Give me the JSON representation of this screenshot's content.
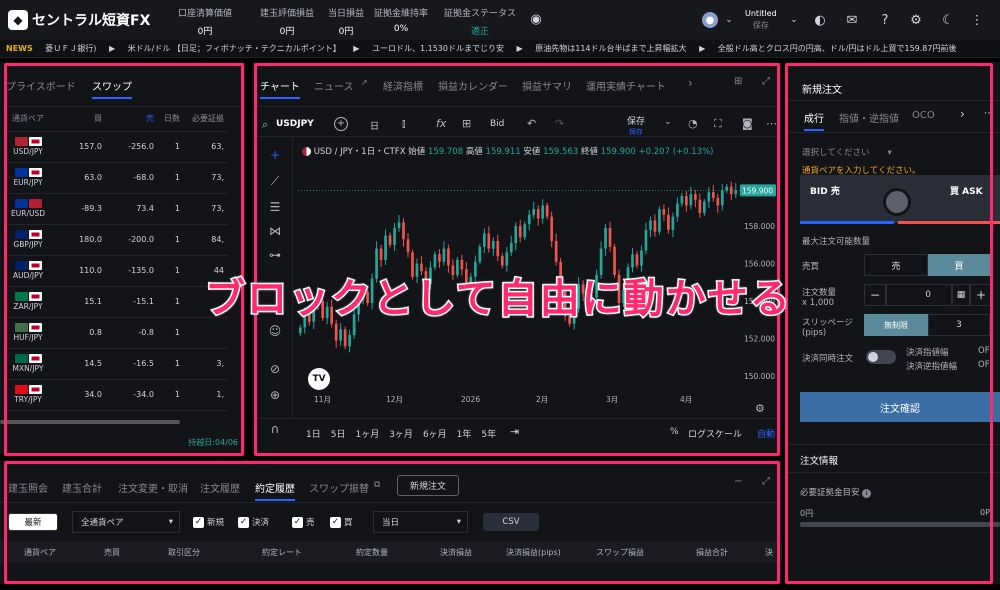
{
  "header": {
    "logo_text": "セントラル短資FX",
    "stats": [
      {
        "label": "口座清算価値",
        "value": "0円"
      },
      {
        "label": "建玉評価損益",
        "value": "0円"
      },
      {
        "label": "当日損益",
        "value": "0円"
      },
      {
        "label": "証拠金維持率",
        "value": "0%"
      },
      {
        "label": "証拠金ステータス",
        "value": "適正"
      }
    ],
    "workspace_name": "Untitled",
    "workspace_status": "保存"
  },
  "ticker": {
    "label": "NEWS",
    "items": [
      "菱ＵＦＪ銀行)",
      "米ドル/ドル 【日足；フィボナッチ・テクニカルポイント】",
      "ユーロドル、1.1530ドルまでじり安",
      "原油先物は114ドル台半ばまで上昇幅拡大",
      "全般ドル高とクロス円の円高、ドル/円はドル上買で159.87円前後"
    ]
  },
  "left_panel": {
    "tabs": [
      "プライスボード",
      "スワップ"
    ],
    "columns": [
      "通貨ペア",
      "買",
      "売",
      "日数",
      "必要証拠"
    ],
    "rows": [
      {
        "pair": "USD/JPY",
        "buy": "157.0",
        "sell": "-256.0",
        "days": "1",
        "margin": "63,"
      },
      {
        "pair": "EUR/JPY",
        "buy": "63.0",
        "sell": "-68.0",
        "days": "1",
        "margin": "73,"
      },
      {
        "pair": "EUR/USD",
        "buy": "-89.3",
        "sell": "73.4",
        "days": "1",
        "margin": "73,"
      },
      {
        "pair": "GBP/JPY",
        "buy": "180.0",
        "sell": "-200.0",
        "days": "1",
        "margin": "84,"
      },
      {
        "pair": "AUD/JPY",
        "buy": "110.0",
        "sell": "-135.0",
        "days": "1",
        "margin": "44"
      },
      {
        "pair": "ZAR/JPY",
        "buy": "15.1",
        "sell": "-15.1",
        "days": "1",
        "margin": ""
      },
      {
        "pair": "HUF/JPY",
        "buy": "0.8",
        "sell": "-0.8",
        "days": "1",
        "margin": ""
      },
      {
        "pair": "MXN/JPY",
        "buy": "14.5",
        "sell": "-16.5",
        "days": "1",
        "margin": "3,"
      },
      {
        "pair": "TRY/JPY",
        "buy": "34.0",
        "sell": "-34.0",
        "days": "1",
        "margin": "1,"
      }
    ],
    "footer": "持越日:04/06"
  },
  "center_panel": {
    "tabs": [
      "チャート",
      "ニュース",
      "経済指標",
      "損益カレンダー",
      "損益サマリ",
      "運用実績チャート"
    ],
    "symbol": "USDJPY",
    "interval": "日",
    "price_type": "Bid",
    "save_label": "保存",
    "save_sub": "保存",
    "legend": {
      "title": "USD / JPY・1日・CTFX",
      "o_label": "始値",
      "o": "159.708",
      "h_label": "高値",
      "h": "159.911",
      "l_label": "安値",
      "l": "159.563",
      "c_label": "終値",
      "c": "159.900",
      "chg": "+0.207 (+0.13%)"
    },
    "ranges": [
      "1日",
      "5日",
      "1ヶ月",
      "3ヶ月",
      "6ヶ月",
      "1年",
      "5年"
    ],
    "bottom_right": {
      "pct": "%",
      "log": "ログスケール",
      "auto": "自動"
    },
    "overlay_text": "ブロックとして自由に動かせる"
  },
  "chart_data": {
    "type": "candlestick",
    "symbol": "USD/JPY",
    "x_tick_labels": [
      "11月",
      "12月",
      "2026",
      "2月",
      "3月",
      "4月"
    ],
    "y_tick_labels": [
      "158.000",
      "156.000",
      "154.000",
      "152.000",
      "150.000"
    ],
    "ylim": [
      149.8,
      161.2
    ],
    "last_price": "159.900",
    "colors": {
      "up": "#26a69a",
      "down": "#ef5350"
    },
    "closes": [
      152.6,
      153.4,
      152.9,
      153.8,
      154.0,
      153.1,
      153.7,
      152.8,
      151.9,
      152.5,
      151.6,
      152.2,
      153.3,
      154.1,
      154.5,
      153.9,
      155.2,
      156.8,
      156.2,
      157.5,
      157.0,
      157.9,
      158.2,
      157.3,
      156.6,
      155.3,
      156.0,
      155.6,
      154.9,
      155.8,
      156.5,
      156.1,
      156.8,
      155.9,
      155.4,
      156.2,
      155.7,
      154.8,
      155.3,
      156.1,
      156.9,
      157.6,
      156.8,
      157.2,
      156.4,
      155.9,
      156.6,
      157.1,
      158.0,
      157.4,
      158.1,
      158.6,
      158.9,
      158.4,
      159.1,
      158.5,
      157.2,
      156.1,
      154.6,
      153.2,
      152.8,
      153.6,
      154.9,
      154.4,
      153.7,
      154.2,
      155.4,
      156.8,
      157.9,
      156.9,
      155.4,
      153.9,
      154.6,
      155.8,
      156.5,
      155.9,
      156.7,
      157.8,
      158.3,
      157.7,
      158.9,
      158.6,
      157.8,
      158.5,
      159.2,
      159.6,
      159.1,
      159.7,
      159.4,
      158.7,
      159.3,
      159.8,
      159.5,
      159.1,
      159.9,
      160.1,
      159.7,
      159.9
    ],
    "grid": false
  },
  "right_panel": {
    "title": "新規注文",
    "tabs": [
      "成行",
      "指値・逆指値",
      "OCO"
    ],
    "select_placeholder": "選択してください",
    "warning": "通貨ペアを入力してください。",
    "bid_label": "BID 売",
    "ask_label": "買 ASK",
    "max_qty_label": "最大注文可能数量",
    "side_label": "売買",
    "sell": "売",
    "buy": "買",
    "qty_label": "注文数量",
    "qty_unit": "x 1,000",
    "qty_value": "0",
    "slip_label": "スリッページ",
    "slip_unit": "(pips)",
    "unlimited": "無制限",
    "slip_value": "3",
    "settle_label": "決済同時注文",
    "settle_limit": "決済指値幅",
    "settle_stop": "決済逆指値幅",
    "settle_limit_val": "OF",
    "settle_stop_val": "OF",
    "confirm": "注文確認",
    "info_title": "注文情報",
    "margin_label": "必要証拠金目安",
    "margin_value": "0円",
    "margin_right": "0P"
  },
  "bottom_panel": {
    "tabs": [
      "建玉照会",
      "建玉合計",
      "注文変更・取消",
      "注文履歴",
      "約定履歴",
      "スワップ振替"
    ],
    "new_order": "新規注文",
    "latest": "最新",
    "pair_select": "全通貨ペア",
    "checks": [
      "新規",
      "決済",
      "売",
      "買"
    ],
    "date_select": "当日",
    "csv": "CSV",
    "columns": [
      "通貨ペア",
      "売買",
      "取引区分",
      "約定レート",
      "約定数量",
      "決済損益",
      "決済損益(pips)",
      "スワップ損益",
      "損益合計",
      "決"
    ]
  }
}
